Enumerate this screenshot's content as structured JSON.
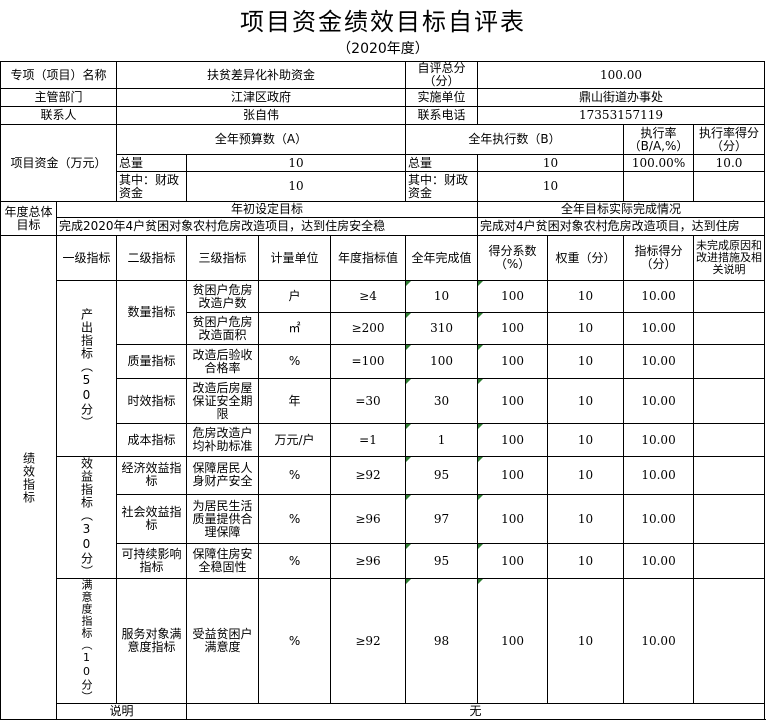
{
  "title": "项目资金绩效目标自评表",
  "year": "（2020年度）",
  "project": {
    "label": "专项（项目）名称",
    "name": "扶贫差异化补助资金",
    "score_label": "自评总分（分）",
    "score": "100.00",
    "dept_label": "主管部门",
    "dept": "江津区政府",
    "impl_label": "实施单位",
    "impl": "鼎山街道办事处",
    "contact_label": "联系人",
    "contact": "张自伟",
    "phone_label": "联系电话",
    "phone": "17353157119"
  },
  "funds": {
    "label": "项目资金（万元）",
    "budget_header": "全年预算数（A）",
    "exec_header": "全年执行数（B）",
    "rate_header": "执行率（B/A,%）",
    "rate_score_header": "执行率得分（分）",
    "total_label": "总量",
    "fiscal_label": "其中：财政资金",
    "budget_total": "10",
    "budget_fiscal": "10",
    "exec_total": "10",
    "exec_fiscal": "10",
    "rate": "100.00%",
    "rate_score": "10.0"
  },
  "goals": {
    "label": "年度总体目标",
    "set_header": "年初设定目标",
    "actual_header": "全年目标实际完成情况",
    "set_text": "完成2020年4户贫困对象农村危房改造项目，达到住房安全稳",
    "actual_text": "完成对4户贫困对象农村危房改造项目，达到住房"
  },
  "indicators": {
    "label": "绩效指标",
    "headers": [
      "一级指标",
      "二级指标",
      "三级指标",
      "计量单位",
      "年度指标值",
      "全年完成值",
      "得分系数（%）",
      "权重（分）",
      "指标得分（分）",
      "未完成原因和改进措施及相关说明"
    ],
    "groups": [
      {
        "level1": "产出指标（50分）"
      },
      {
        "level1": "效益指标（30分）"
      },
      {
        "level1": "满意度指标（10分）"
      }
    ],
    "rows": [
      {
        "l2": "数量指标",
        "l3": "贫困户危房改造户数",
        "unit": "户",
        "target": "≥4",
        "done": "10",
        "coef": "100",
        "weight": "10",
        "score": "10.00",
        "note": ""
      },
      {
        "l2": "",
        "l3": "贫困户危房改造面积",
        "unit": "㎡",
        "target": "≥200",
        "done": "310",
        "coef": "100",
        "weight": "10",
        "score": "10.00",
        "note": ""
      },
      {
        "l2": "质量指标",
        "l3": "改造后验收合格率",
        "unit": "%",
        "target": "=100",
        "done": "100",
        "coef": "100",
        "weight": "10",
        "score": "10.00",
        "note": ""
      },
      {
        "l2": "时效指标",
        "l3": "改造后房屋保证安全期限",
        "unit": "年",
        "target": "=30",
        "done": "30",
        "coef": "100",
        "weight": "10",
        "score": "10.00",
        "note": ""
      },
      {
        "l2": "成本指标",
        "l3": "危房改造户均补助标准",
        "unit": "万元/户",
        "target": "=1",
        "done": "1",
        "coef": "100",
        "weight": "10",
        "score": "10.00",
        "note": ""
      },
      {
        "l2": "经济效益指标",
        "l3": "保障居民人身财产安全",
        "unit": "%",
        "target": "≥92",
        "done": "95",
        "coef": "100",
        "weight": "10",
        "score": "10.00",
        "note": ""
      },
      {
        "l2": "社会效益指标",
        "l3": "为居民生活质量提供合理保障",
        "unit": "%",
        "target": "≥96",
        "done": "97",
        "coef": "100",
        "weight": "10",
        "score": "10.00",
        "note": ""
      },
      {
        "l2": "可持续影响指标",
        "l3": "保障住房安全稳固性",
        "unit": "%",
        "target": "≥96",
        "done": "95",
        "coef": "100",
        "weight": "10",
        "score": "10.00",
        "note": ""
      },
      {
        "l2": "服务对象满意度指标",
        "l3": "受益贫困户满意度",
        "unit": "%",
        "target": "≥92",
        "done": "98",
        "coef": "100",
        "weight": "10",
        "score": "10.00",
        "note": ""
      }
    ]
  },
  "remarks": {
    "label": "说明",
    "value": "无"
  }
}
